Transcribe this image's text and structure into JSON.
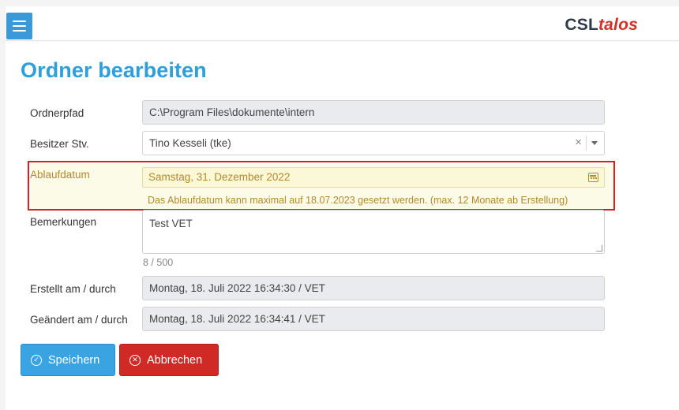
{
  "app": {
    "logo_main": "CSL",
    "logo_accent": "talos",
    "menu_icon": "hamburger-menu-icon"
  },
  "page_title": "Ordner bearbeiten",
  "form": {
    "ordnerpfad": {
      "label": "Ordnerpfad",
      "value": "C:\\Program Files\\dokumente\\intern"
    },
    "besitzer": {
      "label": "Besitzer Stv.",
      "value": "Tino Kesseli (tke)",
      "clear_symbol": "×"
    },
    "ablaufdatum": {
      "label": "Ablaufdatum",
      "value": "Samstag, 31. Dezember 2022",
      "hint": "Das Ablaufdatum kann maximal auf 18.07.2023 gesetzt werden. (max. 12 Monate ab Erstellung)",
      "icon": "calendar-icon",
      "highlight_color": "#d32020",
      "warning_color": "#b5892b"
    },
    "bemerkungen": {
      "label": "Bemerkungen",
      "value": "Test VET",
      "counter": "8 / 500"
    },
    "erstellt": {
      "label": "Erstellt am / durch",
      "value": "Montag, 18. Juli 2022 16:34:30 / VET"
    },
    "geaendert": {
      "label": "Geändert am / durch",
      "value": "Montag, 18. Juli 2022 16:34:41 / VET"
    }
  },
  "buttons": {
    "save": {
      "label": "Speichern",
      "icon": "check-circle-icon",
      "color": "#3aa4e3"
    },
    "cancel": {
      "label": "Abbrechen",
      "icon": "x-circle-icon",
      "color": "#cf2a26"
    }
  }
}
